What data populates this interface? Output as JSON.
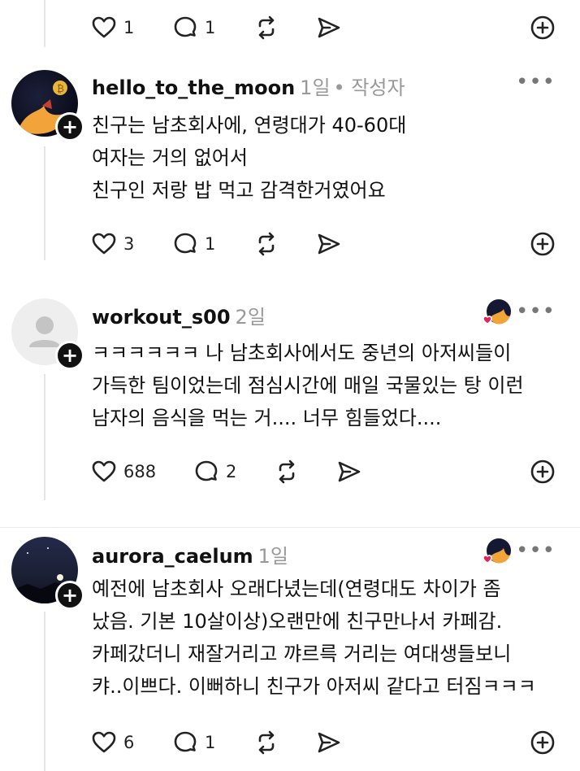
{
  "top_actions": {
    "likes": "1",
    "replies": "1"
  },
  "comments": [
    {
      "username": "hello_to_the_moon",
      "time": "1일",
      "badge": "• 작성자",
      "text": "친구는 남초회사에, 연령대가 40-60대\n여자는 거의 없어서\n친구인 저랑 밥 먹고 감격한거였어요",
      "likes": "3",
      "replies": "1"
    },
    {
      "username": "workout_s00",
      "time": "2일",
      "text": "ㅋㅋㅋㅋㅋㅋ 나 남초회사에서도 중년의 아저씨들이\n가득한 팀이었는데 점심시간에 매일 국물있는 탕 이런\n남자의 음식을 먹는 거.... 너무 힘들었다....",
      "likes": "688",
      "replies": "2"
    },
    {
      "username": "aurora_caelum",
      "time": "1일",
      "text": "예전에 남초회사 오래다녔는데(연령대도 차이가 좀\n났음. 기본 10살이상)오랜만에 친구만나서 카페감.\n카페갔더니 재잘거리고 꺄르륵 거리는 여대생들보니\n캬..이쁘다. 이뻐하니 친구가 아저씨 같다고 터짐ㅋㅋㅋ",
      "likes": "6",
      "replies": "1"
    }
  ],
  "icons": {
    "like": "heart-icon",
    "reply": "comment-bubble-icon",
    "repost": "repost-icon",
    "share": "send-icon",
    "more": "more-dots-icon",
    "follow": "plus-icon"
  },
  "colors": {
    "text": "#111111",
    "meta": "#999999",
    "divider": "#e9e9e9",
    "liked": "#e0245e"
  }
}
